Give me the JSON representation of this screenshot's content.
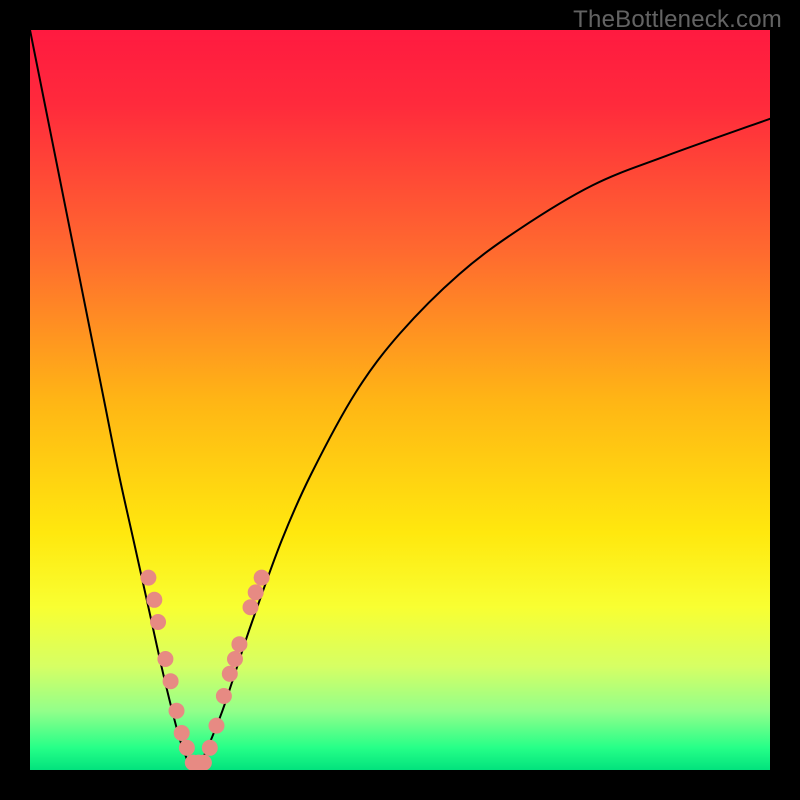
{
  "watermark": "TheBottleneck.com",
  "chart_data": {
    "type": "line",
    "title": "",
    "xlabel": "",
    "ylabel": "",
    "xlim": [
      0,
      100
    ],
    "ylim": [
      0,
      100
    ],
    "grid": false,
    "legend": false,
    "gradient_stops": [
      {
        "offset": 0,
        "color": "#ff1a40"
      },
      {
        "offset": 0.1,
        "color": "#ff2a3c"
      },
      {
        "offset": 0.3,
        "color": "#ff6a2f"
      },
      {
        "offset": 0.5,
        "color": "#ffb515"
      },
      {
        "offset": 0.68,
        "color": "#ffe80e"
      },
      {
        "offset": 0.78,
        "color": "#f8ff32"
      },
      {
        "offset": 0.86,
        "color": "#d6ff64"
      },
      {
        "offset": 0.92,
        "color": "#93ff8a"
      },
      {
        "offset": 0.97,
        "color": "#26ff88"
      },
      {
        "offset": 1.0,
        "color": "#02e27d"
      }
    ],
    "curve_color": "#000000",
    "curve_width": 2,
    "series": [
      {
        "name": "bottleneck-curve",
        "trough_x": 22,
        "x": [
          0,
          2,
          4,
          6,
          8,
          10,
          12,
          14,
          16,
          18,
          20,
          21,
          22,
          23,
          24,
          26,
          28,
          30,
          34,
          38,
          44,
          50,
          58,
          66,
          76,
          86,
          100
        ],
        "y": [
          100,
          90,
          80,
          70,
          60,
          50,
          40,
          31,
          22,
          13,
          5,
          2,
          0,
          1,
          3,
          8,
          14,
          20,
          31,
          40,
          51,
          59,
          67,
          73,
          79,
          83,
          88
        ]
      }
    ],
    "markers": {
      "color": "#e78a83",
      "radius": 8,
      "points": [
        {
          "x": 16.0,
          "y": 26
        },
        {
          "x": 16.8,
          "y": 23
        },
        {
          "x": 17.3,
          "y": 20
        },
        {
          "x": 18.3,
          "y": 15
        },
        {
          "x": 19.0,
          "y": 12
        },
        {
          "x": 19.8,
          "y": 8
        },
        {
          "x": 20.5,
          "y": 5
        },
        {
          "x": 21.2,
          "y": 3
        },
        {
          "x": 22.0,
          "y": 1
        },
        {
          "x": 22.8,
          "y": 1
        },
        {
          "x": 23.5,
          "y": 1
        },
        {
          "x": 24.3,
          "y": 3
        },
        {
          "x": 25.2,
          "y": 6
        },
        {
          "x": 26.2,
          "y": 10
        },
        {
          "x": 27.0,
          "y": 13
        },
        {
          "x": 27.7,
          "y": 15
        },
        {
          "x": 28.3,
          "y": 17
        },
        {
          "x": 29.8,
          "y": 22
        },
        {
          "x": 30.5,
          "y": 24
        },
        {
          "x": 31.3,
          "y": 26
        }
      ]
    }
  }
}
